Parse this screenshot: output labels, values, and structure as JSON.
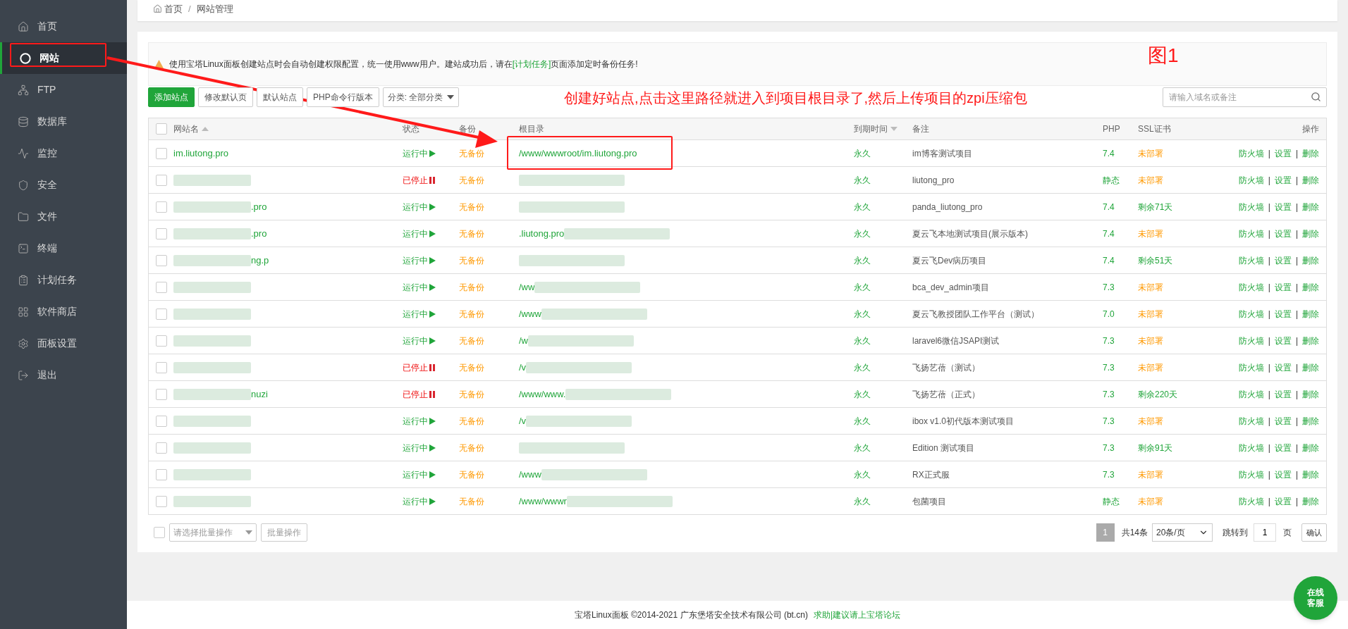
{
  "sidebar": {
    "items": [
      {
        "label": "首页",
        "selected": false
      },
      {
        "label": "网站",
        "selected": true
      },
      {
        "label": "FTP",
        "selected": false
      },
      {
        "label": "数据库",
        "selected": false
      },
      {
        "label": "监控",
        "selected": false
      },
      {
        "label": "安全",
        "selected": false
      },
      {
        "label": "文件",
        "selected": false
      },
      {
        "label": "终端",
        "selected": false
      },
      {
        "label": "计划任务",
        "selected": false
      },
      {
        "label": "软件商店",
        "selected": false
      },
      {
        "label": "面板设置",
        "selected": false
      },
      {
        "label": "退出",
        "selected": false
      }
    ]
  },
  "breadcrumb": [
    {
      "label": "首页",
      "kind": "link"
    },
    {
      "label": "/",
      "kind": "separator"
    },
    {
      "label": "网站管理",
      "kind": "link"
    }
  ],
  "notice": {
    "before": "使用宝塔Linux面板创建站点时会自动创建权限配置，统一使用www用户。建站成功后，请在",
    "link": "[计划任务]",
    "after": "页面添加定时备份任务!"
  },
  "toolbar": {
    "buttons": [
      {
        "label": "添加站点",
        "kind": "primary"
      },
      {
        "label": "修改默认页",
        "kind": "default"
      },
      {
        "label": "默认站点",
        "kind": "default"
      },
      {
        "label": "PHP命令行版本",
        "kind": "default"
      }
    ],
    "category": "分类: 全部分类",
    "search": {
      "placeholder": "请输入域名或备注"
    }
  },
  "table": {
    "all_checked": false,
    "columns": [
      {
        "label": "网站名",
        "sort_up": true
      },
      {
        "label": "状态"
      },
      {
        "label": "备份"
      },
      {
        "label": "根目录"
      },
      {
        "label": "到期时间",
        "sort_down": true
      },
      {
        "label": "备注"
      },
      {
        "label": "PHP"
      },
      {
        "label": "SSL证书"
      },
      {
        "label": "操作"
      }
    ],
    "rows": [
      {
        "checked": false,
        "name": "im.liutong.pro",
        "name_redacted": false,
        "status": "运行中",
        "running": true,
        "backup": "无备份",
        "path": "/www/wwwroot/im.liutong.pro",
        "path_redacted": false,
        "expire": "永久",
        "note": "im博客测试项目",
        "php": "7.4",
        "ssl": "未部署",
        "ssl_deployed": false,
        "actions": [
          {
            "label": "防火墙",
            "kind": "link"
          },
          {
            "label": "|",
            "kind": "separator"
          },
          {
            "label": "设置",
            "kind": "link"
          },
          {
            "label": "|",
            "kind": "separator"
          },
          {
            "label": "删除",
            "kind": "link"
          }
        ]
      },
      {
        "checked": false,
        "name_redacted": true,
        "status": "已停止",
        "running": false,
        "backup": "无备份",
        "path_redacted": true,
        "expire": "永久",
        "note": "liutong_pro",
        "php": "静态",
        "ssl": "未部署",
        "ssl_deployed": false,
        "actions": [
          {
            "label": "防火墙",
            "kind": "link"
          },
          {
            "label": "|",
            "kind": "separator"
          },
          {
            "label": "设置",
            "kind": "link"
          },
          {
            "label": "|",
            "kind": "separator"
          },
          {
            "label": "删除",
            "kind": "link"
          }
        ]
      },
      {
        "checked": false,
        "name": ".pro",
        "name_redacted": true,
        "status": "运行中",
        "running": true,
        "backup": "无备份",
        "path_redacted": true,
        "expire": "永久",
        "note": "panda_liutong_pro",
        "php": "7.4",
        "ssl": "剩余71天",
        "ssl_deployed": true,
        "actions": [
          {
            "label": "防火墙",
            "kind": "link"
          },
          {
            "label": "|",
            "kind": "separator"
          },
          {
            "label": "设置",
            "kind": "link"
          },
          {
            "label": "|",
            "kind": "separator"
          },
          {
            "label": "删除",
            "kind": "link"
          }
        ]
      },
      {
        "checked": false,
        "name": ".pro",
        "name_redacted": true,
        "status": "运行中",
        "running": true,
        "backup": "无备份",
        "path": ".liutong.pro",
        "path_redacted": true,
        "expire": "永久",
        "note": "夏云飞本地测试项目(展示版本)",
        "php": "7.4",
        "ssl": "未部署",
        "ssl_deployed": false,
        "actions": [
          {
            "label": "防火墙",
            "kind": "link"
          },
          {
            "label": "|",
            "kind": "separator"
          },
          {
            "label": "设置",
            "kind": "link"
          },
          {
            "label": "|",
            "kind": "separator"
          },
          {
            "label": "删除",
            "kind": "link"
          }
        ]
      },
      {
        "checked": false,
        "name": "ng.p",
        "name_redacted": true,
        "status": "运行中",
        "running": true,
        "backup": "无备份",
        "path_redacted": true,
        "expire": "永久",
        "note": "夏云飞Dev病历项目",
        "php": "7.4",
        "ssl": "剩余51天",
        "ssl_deployed": true,
        "actions": [
          {
            "label": "防火墙",
            "kind": "link"
          },
          {
            "label": "|",
            "kind": "separator"
          },
          {
            "label": "设置",
            "kind": "link"
          },
          {
            "label": "|",
            "kind": "separator"
          },
          {
            "label": "删除",
            "kind": "link"
          }
        ]
      },
      {
        "checked": false,
        "name_redacted": true,
        "status": "运行中",
        "running": true,
        "backup": "无备份",
        "path": "/ww",
        "path_redacted": true,
        "expire": "永久",
        "note": "bca_dev_admin项目",
        "php": "7.3",
        "ssl": "未部署",
        "ssl_deployed": false,
        "actions": [
          {
            "label": "防火墙",
            "kind": "link"
          },
          {
            "label": "|",
            "kind": "separator"
          },
          {
            "label": "设置",
            "kind": "link"
          },
          {
            "label": "|",
            "kind": "separator"
          },
          {
            "label": "删除",
            "kind": "link"
          }
        ]
      },
      {
        "checked": false,
        "name_redacted": true,
        "status": "运行中",
        "running": true,
        "backup": "无备份",
        "path": "/www",
        "path_redacted": true,
        "expire": "永久",
        "note": "夏云飞教授团队工作平台（测试）",
        "php": "7.0",
        "ssl": "未部署",
        "ssl_deployed": false,
        "actions": [
          {
            "label": "防火墙",
            "kind": "link"
          },
          {
            "label": "|",
            "kind": "separator"
          },
          {
            "label": "设置",
            "kind": "link"
          },
          {
            "label": "|",
            "kind": "separator"
          },
          {
            "label": "删除",
            "kind": "link"
          }
        ]
      },
      {
        "checked": false,
        "name_redacted": true,
        "status": "运行中",
        "running": true,
        "backup": "无备份",
        "path": "/w",
        "path_redacted": true,
        "expire": "永久",
        "note": "laravel6微信JSAPI测试",
        "php": "7.3",
        "ssl": "未部署",
        "ssl_deployed": false,
        "actions": [
          {
            "label": "防火墙",
            "kind": "link"
          },
          {
            "label": "|",
            "kind": "separator"
          },
          {
            "label": "设置",
            "kind": "link"
          },
          {
            "label": "|",
            "kind": "separator"
          },
          {
            "label": "删除",
            "kind": "link"
          }
        ]
      },
      {
        "checked": false,
        "name_redacted": true,
        "status": "已停止",
        "running": false,
        "backup": "无备份",
        "path": "/v",
        "path_redacted": true,
        "expire": "永久",
        "note": "飞扬艺蓓（测试）",
        "php": "7.3",
        "ssl": "未部署",
        "ssl_deployed": false,
        "actions": [
          {
            "label": "防火墙",
            "kind": "link"
          },
          {
            "label": "|",
            "kind": "separator"
          },
          {
            "label": "设置",
            "kind": "link"
          },
          {
            "label": "|",
            "kind": "separator"
          },
          {
            "label": "删除",
            "kind": "link"
          }
        ]
      },
      {
        "checked": false,
        "name": "nuzi",
        "name_redacted": true,
        "status": "已停止",
        "running": false,
        "backup": "无备份",
        "path": "/www/www.",
        "path_redacted": true,
        "expire": "永久",
        "note": "飞扬艺蓓（正式）",
        "php": "7.3",
        "ssl": "剩余220天",
        "ssl_deployed": true,
        "actions": [
          {
            "label": "防火墙",
            "kind": "link"
          },
          {
            "label": "|",
            "kind": "separator"
          },
          {
            "label": "设置",
            "kind": "link"
          },
          {
            "label": "|",
            "kind": "separator"
          },
          {
            "label": "删除",
            "kind": "link"
          }
        ]
      },
      {
        "checked": false,
        "name_redacted": true,
        "status": "运行中",
        "running": true,
        "backup": "无备份",
        "path": "/v",
        "path_redacted": true,
        "expire": "永久",
        "note": "ibox v1.0初代版本测试项目",
        "php": "7.3",
        "ssl": "未部署",
        "ssl_deployed": false,
        "actions": [
          {
            "label": "防火墙",
            "kind": "link"
          },
          {
            "label": "|",
            "kind": "separator"
          },
          {
            "label": "设置",
            "kind": "link"
          },
          {
            "label": "|",
            "kind": "separator"
          },
          {
            "label": "删除",
            "kind": "link"
          }
        ]
      },
      {
        "checked": false,
        "name_redacted": true,
        "status": "运行中",
        "running": true,
        "backup": "无备份",
        "path_redacted": true,
        "expire": "永久",
        "note": "Edition 测试项目",
        "php": "7.3",
        "ssl": "剩余91天",
        "ssl_deployed": true,
        "actions": [
          {
            "label": "防火墙",
            "kind": "link"
          },
          {
            "label": "|",
            "kind": "separator"
          },
          {
            "label": "设置",
            "kind": "link"
          },
          {
            "label": "|",
            "kind": "separator"
          },
          {
            "label": "删除",
            "kind": "link"
          }
        ]
      },
      {
        "checked": false,
        "name_redacted": true,
        "status": "运行中",
        "running": true,
        "backup": "无备份",
        "path": "/www",
        "path_redacted": true,
        "expire": "永久",
        "note": "RX正式服",
        "php": "7.3",
        "ssl": "未部署",
        "ssl_deployed": false,
        "actions": [
          {
            "label": "防火墙",
            "kind": "link"
          },
          {
            "label": "|",
            "kind": "separator"
          },
          {
            "label": "设置",
            "kind": "link"
          },
          {
            "label": "|",
            "kind": "separator"
          },
          {
            "label": "删除",
            "kind": "link"
          }
        ]
      },
      {
        "checked": false,
        "name_redacted": true,
        "status": "运行中",
        "running": true,
        "backup": "无备份",
        "path": "/www/wwwr",
        "path_redacted": true,
        "expire": "永久",
        "note": "包菌项目",
        "php": "静态",
        "ssl": "未部署",
        "ssl_deployed": false,
        "actions": [
          {
            "label": "防火墙",
            "kind": "link"
          },
          {
            "label": "|",
            "kind": "separator"
          },
          {
            "label": "设置",
            "kind": "link"
          },
          {
            "label": "|",
            "kind": "separator"
          },
          {
            "label": "删除",
            "kind": "link"
          }
        ]
      }
    ]
  },
  "pagination": {
    "checked": false,
    "batch_select": "请选择批量操作",
    "batch_button": "批量操作",
    "page": "1",
    "total": "共14条",
    "page_size": "20条/页",
    "jump_label": "跳转到",
    "jump_value": "1",
    "page_unit": "页",
    "confirm": "确认"
  },
  "footer": {
    "text": "宝塔Linux面板 ©2014-2021 广东堡塔安全技术有限公司 (bt.cn)",
    "link": "求助|建议请上宝塔论坛"
  },
  "chat_button": "在线客服",
  "annotations": [
    {
      "kind": "caption",
      "text": "创建好站点,点击这里路径就进入到项目根目录了,然后上传项目的zpi压缩包"
    },
    {
      "kind": "figure_label",
      "text": "图1"
    }
  ]
}
